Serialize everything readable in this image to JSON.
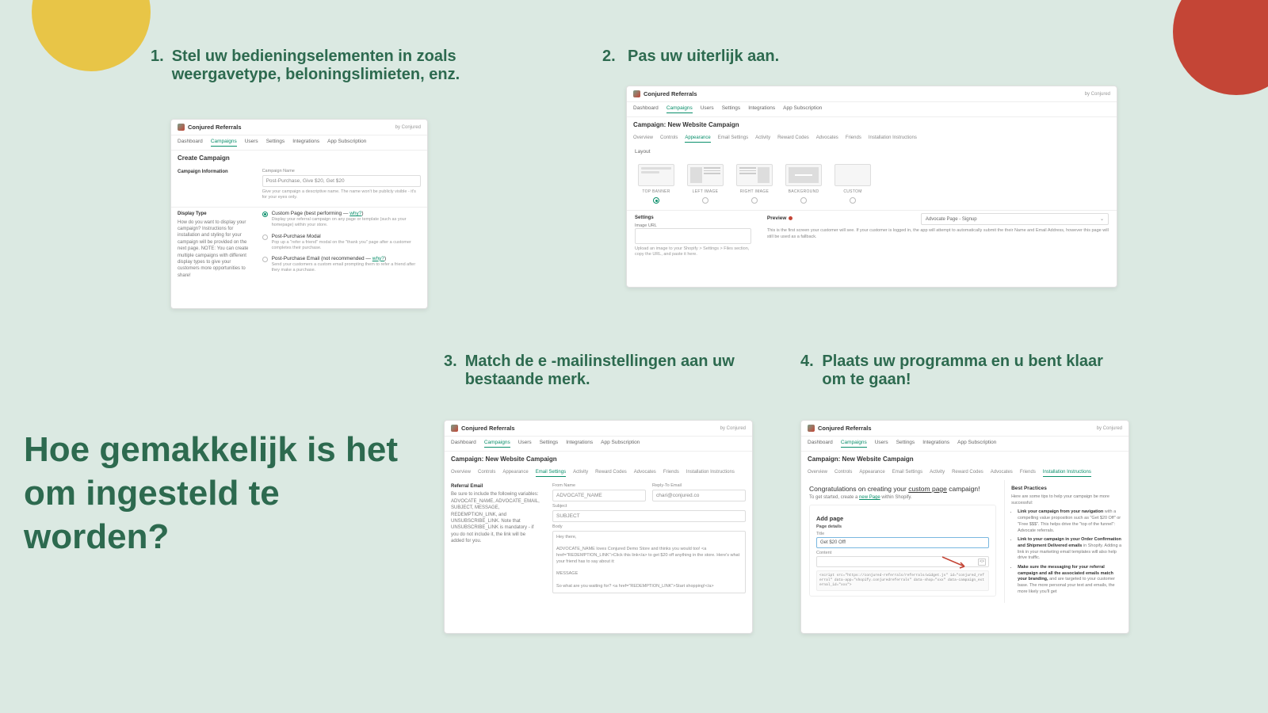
{
  "headline": "Hoe gemakkelijk is het om ingesteld te worden?",
  "steps": {
    "s1": {
      "num": "1.",
      "text": "Stel uw bedieningselementen in zoals weergavetype, beloningslimieten, enz."
    },
    "s2": {
      "num": "2.",
      "text": "Pas uw uiterlijk aan."
    },
    "s3": {
      "num": "3.",
      "text": "Match de e -mailinstellingen aan uw bestaande merk."
    },
    "s4": {
      "num": "4.",
      "text": "Plaats uw programma en u bent klaar om te gaan!"
    }
  },
  "common": {
    "brand": "Conjured Referrals",
    "by": "by Conjured",
    "nav": [
      "Dashboard",
      "Campaigns",
      "Users",
      "Settings",
      "Integrations",
      "App Subscription"
    ],
    "nav_active": "Campaigns",
    "campaign_title": "Campaign: New Website Campaign",
    "subnav": [
      "Overview",
      "Controls",
      "Appearance",
      "Email Settings",
      "Activity",
      "Reward Codes",
      "Advocates",
      "Friends",
      "Installation Instructions"
    ]
  },
  "p1": {
    "header": "Create Campaign",
    "info_lbl": "Campaign Information",
    "name_lbl": "Campaign Name",
    "name_val": "Post-Purchase, Give $20, Get $20",
    "name_hint": "Give your campaign a descriptive name. The name won't be publicly visible - it's for your eyes only.",
    "dt_lbl": "Display Type",
    "dt_desc": "How do you want to display your campaign? Instructions for installation and styling for your campaign will be provided on the next page. NOTE: You can create multiple campaigns with different display types to give your customers more opportunities to share!",
    "opts": [
      {
        "title": "Custom Page (best performing — ",
        "why": "why?",
        "end": ")",
        "desc": "Display your referral campaign on any page or template (such as your homepage) within your store.",
        "sel": true
      },
      {
        "title": "Post-Purchase Modal",
        "desc": "Pop up a \"refer a friend\" modal on the \"thank you\" page after a customer completes their purchase.",
        "sel": false
      },
      {
        "title": "Post-Purchase Email (not recommended — ",
        "why": "why?",
        "end": ")",
        "desc": "Send your customers a custom email prompting them to refer a friend after they make a purchase.",
        "sel": false
      }
    ]
  },
  "p2": {
    "active_sub": "Appearance",
    "layout_h": "Layout",
    "layouts": [
      "TOP BANNER",
      "LEFT IMAGE",
      "RIGHT IMAGE",
      "BACKGROUND",
      "CUSTOM"
    ],
    "layout_sel": 0,
    "custom_glyph": "</>",
    "settings_h": "Settings",
    "img_lbl": "Image URL",
    "img_hint": "Upload an image to your Shopify > Settings > Files section, copy the URL, and paste it here.",
    "preview_h": "Preview",
    "preview_sel": "Advocate Page - Signup",
    "preview_txt": "This is the first screen your customer will see. If your customer is logged in, the app will attempt to automatically submit the their Name and Email Address, however this page will still be used as a fallback."
  },
  "p3": {
    "active_sub": "Email Settings",
    "ref_h": "Referral Email",
    "ref_desc": "Be sure to include the following variables: ADVOCATE_NAME, ADVOCATE_EMAIL, SUBJECT, MESSAGE, REDEMPTION_LINK, and UNSUBSCRIBE_LINK. Note that UNSUBSCRIBE_LINK is mandatory - if you do not include it, the link will be added for you.",
    "from_lbl": "From Name",
    "from_val": "ADVOCATE_NAME",
    "reply_lbl": "Reply-To Email",
    "reply_val": "chari@conjured.co",
    "subj_lbl": "Subject",
    "subj_val": "SUBJECT",
    "body_lbl": "Body",
    "body_txt": "Hey there,\n\nADVOCATE_NAME loves Conjured Demo Store and thinks you would too! <a href=\"REDEMPTION_LINK\">Click this link</a> to get $20 off anything in the store. Here's what your friend has to say about it:\n\nMESSAGE\n\nSo what are you waiting for? <a href=\"REDEMPTION_LINK\">Start shopping!</a>"
  },
  "p4": {
    "active_sub": "Installation Instructions",
    "cong_a": "Congratulations on creating your ",
    "cong_b": "custom page",
    "cong_c": " campaign!",
    "start": "To get started, create a ",
    "start_link": "new Page",
    "start_b": " within Shopify.",
    "add_h": "Add page",
    "det_h": "Page details",
    "title_lbl": "Title",
    "title_val": "Get $20 Off!",
    "content_lbl": "Content",
    "code": "<script src=\"https://conjured-referrals/referrals/widget.js\" id=\"conjured_referral\" data-app=\"shopify.conjuredreferrals\" data-shop=\"xxx\" data-campaign_external_id=\"xxx\">",
    "bp_h": "Best Practices",
    "bp_intro": "Here are some tips to help your campaign be more successful:",
    "bp": [
      {
        "b": "Link your campaign from your navigation",
        "t": " with a compelling value proposition such as \"Get $20 Off\" or \"Free $$$\". This helps drive the \"top of the funnel\": Advocate referrals."
      },
      {
        "b": "Link to your campaign in your Order Confirmation and Shipment Delivered emails",
        "t": " in Shopify. Adding a link in your marketing email templates will also help drive traffic."
      },
      {
        "b": "Make sure the messaging for your referral campaign and all the associated emails match your branding,",
        "t": " and are targeted to your customer base. The more personal your text and emails, the more likely you'll get"
      }
    ]
  }
}
